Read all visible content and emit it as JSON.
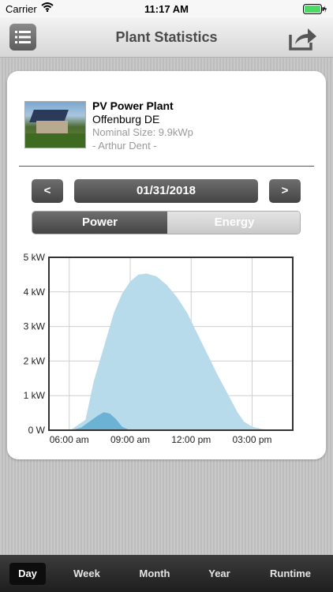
{
  "status_bar": {
    "carrier": "Carrier",
    "time": "11:17 AM"
  },
  "navbar": {
    "title": "Plant Statistics",
    "menu_icon": "list-icon",
    "share_icon": "share-icon"
  },
  "plant": {
    "name": "PV Power Plant",
    "location": "Offenburg DE",
    "nominal_size": "Nominal Size: 9.9kWp",
    "owner": "- Arthur Dent -"
  },
  "date_nav": {
    "prev_label": "<",
    "date": "01/31/2018",
    "next_label": ">"
  },
  "segment": {
    "power_label": "Power",
    "energy_label": "Energy",
    "selected": "Power"
  },
  "chart_data": {
    "type": "area",
    "y_tick_labels": [
      "5 kW",
      "4 kW",
      "3 kW",
      "2 kW",
      "1 kW",
      "0 W"
    ],
    "x_tick_labels": [
      "06:00 am",
      "09:00 am",
      "12:00 pm",
      "03:00 pm"
    ],
    "ylim": [
      0,
      5
    ],
    "xlim": [
      5.0,
      17.0
    ],
    "grid": true,
    "series": [
      {
        "color": "#b8dbec",
        "x": [
          5.0,
          6.1,
          6.8,
          7.2,
          7.8,
          8.2,
          8.6,
          9.0,
          9.4,
          9.8,
          10.3,
          10.8,
          11.3,
          11.8,
          12.3,
          12.8,
          13.3,
          13.8,
          14.3,
          14.6,
          15.0,
          15.5,
          16.0,
          17.0
        ],
        "y": [
          0,
          0.02,
          0.3,
          1.4,
          2.6,
          3.4,
          3.95,
          4.3,
          4.5,
          4.53,
          4.45,
          4.2,
          3.85,
          3.4,
          2.8,
          2.2,
          1.6,
          1.05,
          0.5,
          0.25,
          0.1,
          0.03,
          0.01,
          0
        ]
      },
      {
        "color": "#6cb2d4",
        "x": [
          5.0,
          6.1,
          6.6,
          7.0,
          7.4,
          7.7,
          8.0,
          8.3,
          8.6,
          9.0,
          17.0
        ],
        "y": [
          0,
          0,
          0.08,
          0.25,
          0.42,
          0.52,
          0.48,
          0.32,
          0.1,
          0,
          0
        ]
      }
    ]
  },
  "tabs": [
    {
      "label": "Day",
      "active": true
    },
    {
      "label": "Week",
      "active": false
    },
    {
      "label": "Month",
      "active": false
    },
    {
      "label": "Year",
      "active": false
    },
    {
      "label": "Runtime",
      "active": false
    }
  ]
}
